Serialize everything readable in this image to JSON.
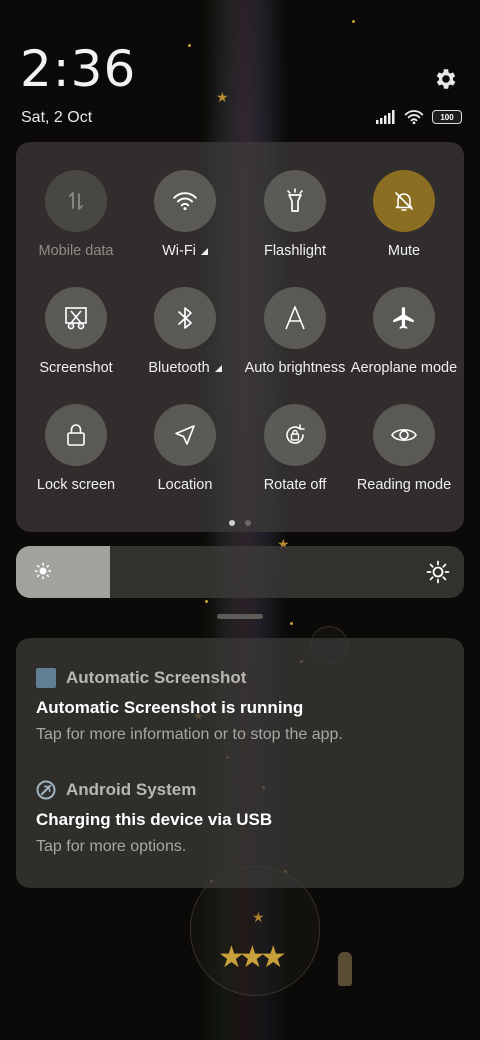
{
  "status": {
    "time": "2:36",
    "date": "Sat, 2 Oct",
    "battery": "100",
    "icons": [
      "settings-icon",
      "signal-icon",
      "wifi-icon",
      "battery-icon"
    ]
  },
  "quick_settings": {
    "tiles": [
      {
        "label": "Mobile data",
        "icon": "mobile-data-icon",
        "state": "disabled"
      },
      {
        "label": "Wi-Fi",
        "icon": "wifi-icon",
        "state": "on",
        "expand": true
      },
      {
        "label": "Flashlight",
        "icon": "flashlight-icon",
        "state": "off"
      },
      {
        "label": "Mute",
        "icon": "bell-off-icon",
        "state": "active"
      },
      {
        "label": "Screenshot",
        "icon": "scissors-icon",
        "state": "off"
      },
      {
        "label": "Bluetooth",
        "icon": "bluetooth-icon",
        "state": "off",
        "expand": true
      },
      {
        "label": "Auto brightness",
        "icon": "auto-brightness-icon",
        "state": "off"
      },
      {
        "label": "Aeroplane mode",
        "icon": "airplane-icon",
        "state": "off"
      },
      {
        "label": "Lock screen",
        "icon": "lock-icon",
        "state": "off"
      },
      {
        "label": "Location",
        "icon": "location-arrow-icon",
        "state": "off"
      },
      {
        "label": "Rotate off",
        "icon": "rotate-lock-icon",
        "state": "off"
      },
      {
        "label": "Reading mode",
        "icon": "eye-icon",
        "state": "off"
      }
    ],
    "page_count": 2,
    "current_page": 1
  },
  "brightness": {
    "level": 0.21,
    "low_icon": "brightness-low-icon",
    "high_icon": "brightness-high-icon"
  },
  "notifications": [
    {
      "app": "Automatic Screenshot",
      "app_icon": "app-square-icon",
      "title": "Automatic Screenshot is running",
      "text": "Tap for more information or to stop the app."
    },
    {
      "app": "Android System",
      "app_icon": "android-system-icon",
      "title": "Charging this device via USB",
      "text": "Tap for more options."
    }
  ],
  "colors": {
    "mute_active": "#8a6e22",
    "panel": "#3e3c3a",
    "accent_star": "#b58a2e"
  }
}
